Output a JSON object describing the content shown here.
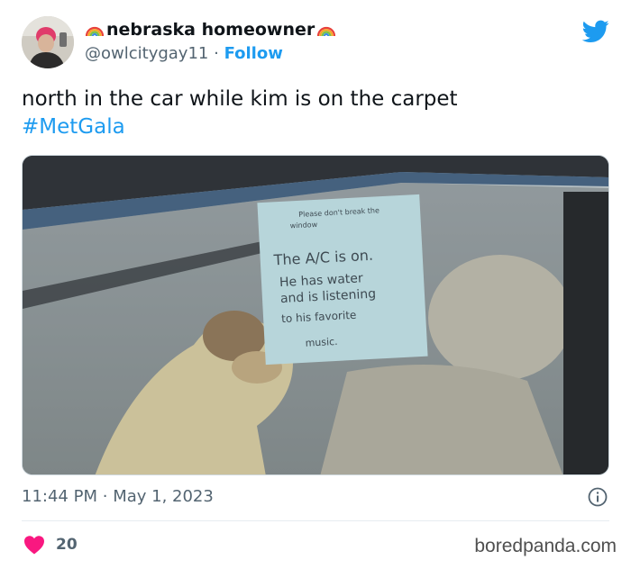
{
  "tweet": {
    "display_name": "nebraska homeowner",
    "handle": "@owlcitygay11",
    "separator": "·",
    "follow_label": "Follow",
    "text": "north in the car while kim is on the carpet",
    "hashtag": "#MetGala",
    "time": "11:44 PM",
    "date": "May 1, 2023",
    "likes": "20"
  },
  "media": {
    "sign_lines": [
      "Please don't break the",
      "window",
      "The A/C is on.",
      "He has water",
      "and is listening",
      "to his favorite",
      "music."
    ]
  },
  "watermark": "boredpanda.com",
  "icons": {
    "brand": "twitter-bird-icon",
    "name_decoration": "rainbow-emoji-icon",
    "info": "info-icon",
    "like": "heart-icon"
  },
  "colors": {
    "accent": "#1d9bf0",
    "like": "#f91880",
    "muted": "#536471"
  }
}
